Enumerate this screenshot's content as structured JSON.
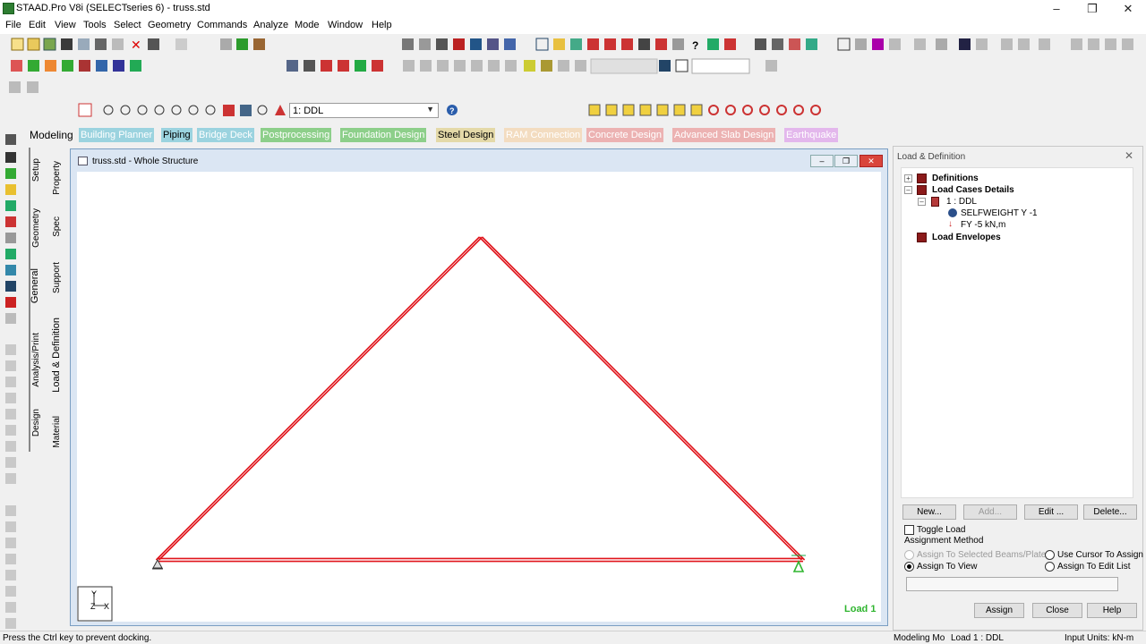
{
  "window": {
    "title": "STAAD.Pro V8i (SELECTseries 6) - truss.std"
  },
  "menu": [
    "File",
    "Edit",
    "View",
    "Tools",
    "Select",
    "Geometry",
    "Commands",
    "Analyze",
    "Mode",
    "Window",
    "Help"
  ],
  "toolbar": {
    "load_case_select": "1: DDL"
  },
  "page_tabs": {
    "modeling": "Modeling",
    "items": [
      {
        "label": "Building Planner",
        "bg": "#9bd3df",
        "fg": "#ffffff"
      },
      {
        "label": "Piping",
        "bg": "#9bd3df",
        "fg": "#000000"
      },
      {
        "label": "Bridge Deck",
        "bg": "#9bd3df",
        "fg": "#ffffff"
      },
      {
        "label": "Postprocessing",
        "bg": "#8dcf8a",
        "fg": "#ffffff"
      },
      {
        "label": "Foundation Design",
        "bg": "#8dcf8a",
        "fg": "#ffffff"
      },
      {
        "label": "Steel Design",
        "bg": "#e4d9a8",
        "fg": "#000000"
      },
      {
        "label": "RAM Connection",
        "bg": "#f3dcc0",
        "fg": "#ffffff"
      },
      {
        "label": "Concrete Design",
        "bg": "#ecb2b2",
        "fg": "#ffffff"
      },
      {
        "label": "Advanced Slab Design",
        "bg": "#ecb2b2",
        "fg": "#ffffff"
      },
      {
        "label": "Earthquake",
        "bg": "#e3b7ec",
        "fg": "#ffffff"
      }
    ]
  },
  "side_tabs": {
    "outer": [
      "Setup",
      "Geometry",
      "General",
      "Analysis/Print",
      "Design"
    ],
    "inner": [
      "Property",
      "Spec",
      "Support",
      "Load & Definition",
      "Material"
    ]
  },
  "view_window": {
    "title": "truss.std - Whole Structure",
    "load_label": "Load 1",
    "axis_y": "Y",
    "axis_z": "Z",
    "axis_x": "X",
    "member_color": "#e0141b"
  },
  "panel": {
    "title": "Load & Definition",
    "tree": {
      "definitions": "Definitions",
      "load_cases": "Load Cases Details",
      "case_1": "1 : DDL",
      "selfweight": "SELFWEIGHT Y -1",
      "fy": "FY -5 kN,m",
      "envelopes": "Load Envelopes"
    },
    "buttons": {
      "new": "New...",
      "add": "Add...",
      "edit": "Edit ...",
      "delete": "Delete..."
    },
    "toggle_load": "Toggle Load",
    "assignment_method": "Assignment Method",
    "opt_selected": "Assign To Selected Beams/Plates",
    "opt_cursor": "Use Cursor To Assign",
    "opt_view": "Assign To View",
    "opt_edit_list": "Assign To Edit List",
    "bottom_buttons": {
      "assign": "Assign",
      "close": "Close",
      "help": "Help"
    }
  },
  "status": {
    "hint": "Press the Ctrl key to prevent docking.",
    "mode": "Modeling Mo",
    "load": "Load 1 : DDL",
    "units": "Input Units:  kN-m"
  }
}
